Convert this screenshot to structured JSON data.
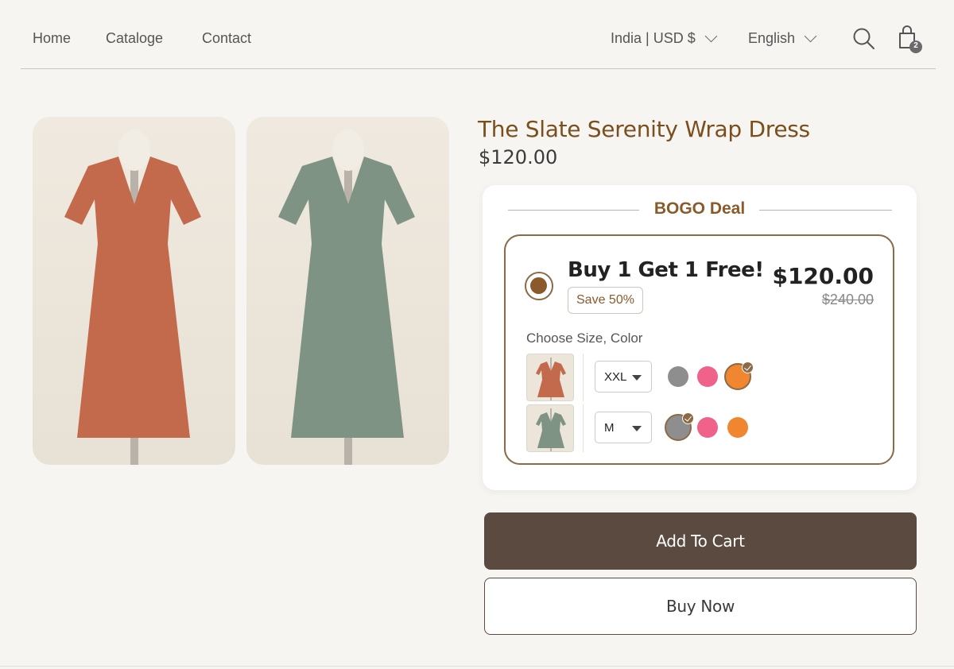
{
  "nav": {
    "links": [
      "Home",
      "Cataloge",
      "Contact"
    ],
    "locale": "India | USD $",
    "language": "English",
    "cart_count": "2"
  },
  "gallery": {
    "images": [
      {
        "icon": "terracotta-wrap-dress-image",
        "color": "#c46a4c"
      },
      {
        "icon": "sage-wrap-dress-image",
        "color": "#7f9384"
      }
    ]
  },
  "product": {
    "title": "The Slate Serenity Wrap Dress",
    "price": "$120.00"
  },
  "deal": {
    "heading": "BOGO Deal",
    "offer_title": "Buy 1 Get 1 Free!",
    "save_badge": "Save 50%",
    "price": "$120.00",
    "old_price": "$240.00",
    "choose_label": "Choose Size, Color",
    "variants": [
      {
        "size": "XXL",
        "thumb_color": "#c46a4c",
        "selected_swatch": 2
      },
      {
        "size": "M",
        "thumb_color": "#7f9384",
        "selected_swatch": 0
      }
    ],
    "swatch_colors": [
      "#8e8e8e",
      "#f0628a",
      "#f08630"
    ]
  },
  "actions": {
    "add_to_cart": "Add To Cart",
    "buy_now": "Buy Now"
  },
  "colors": {
    "accent": "#8a5a2a",
    "button_dark": "#5a4a3f"
  }
}
